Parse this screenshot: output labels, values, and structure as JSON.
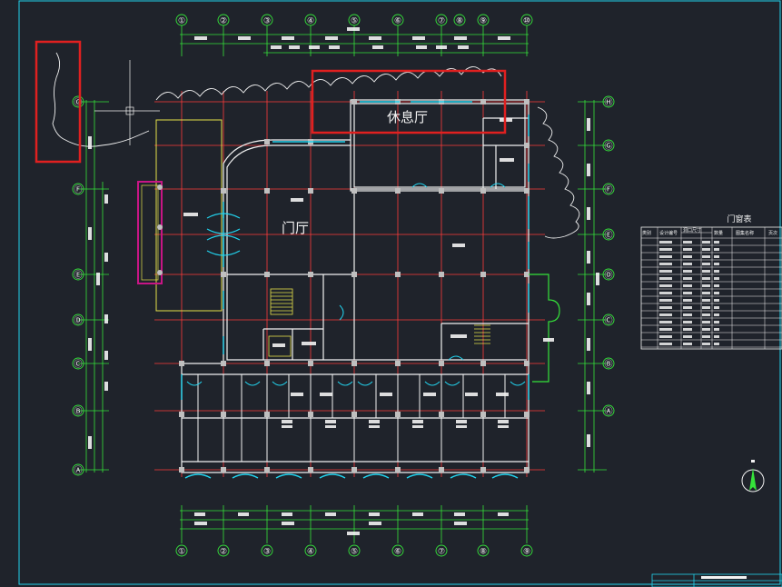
{
  "drawing": {
    "colors": {
      "background": "#1f232b",
      "frame": "#22d3ee",
      "axis": "#ff3b3b",
      "wall": "#f2f2f2",
      "dim": "#35e33a",
      "window": "#22d3ee",
      "highlight": "#e02020",
      "yellow": "#e5e04a",
      "magenta": "#c71585"
    },
    "room_labels": {
      "lounge": "休息厅",
      "lobby": "门厅"
    },
    "axis_labels_top": [
      "①",
      "②",
      "③",
      "④",
      "⑤",
      "⑥",
      "⑦",
      "⑧",
      "⑨",
      "⑩"
    ],
    "axis_labels_bottom": [
      "①",
      "②",
      "③",
      "④",
      "⑤",
      "⑥",
      "⑦",
      "⑧",
      "⑨"
    ],
    "axis_labels_left": [
      "Ⓖ",
      "Ⓕ",
      "Ⓔ",
      "Ⓓ",
      "Ⓒ",
      "Ⓑ",
      "Ⓐ"
    ],
    "axis_labels_right": [
      "Ⓗ",
      "Ⓖ",
      "Ⓕ",
      "Ⓔ",
      "Ⓓ",
      "Ⓒ",
      "Ⓑ",
      "Ⓐ"
    ],
    "door_table": {
      "title": "门窗表",
      "headers": [
        "类别",
        "设计编号",
        "洞口尺寸",
        "数量",
        "图集名称",
        "页次"
      ]
    }
  }
}
